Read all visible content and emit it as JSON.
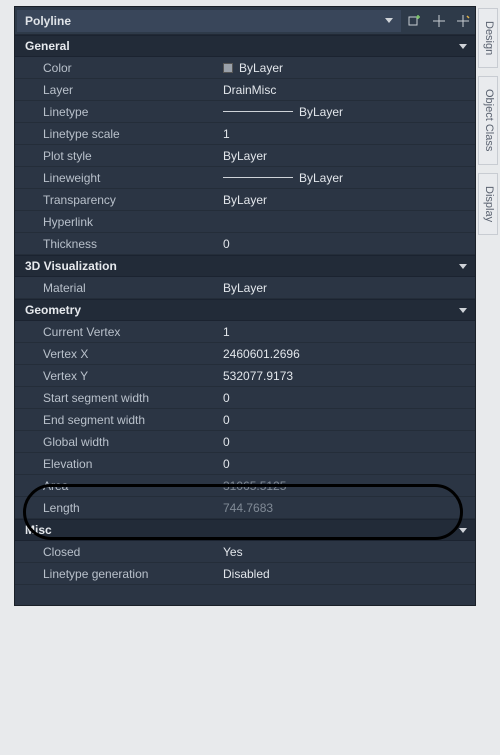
{
  "selector": {
    "value": "Polyline"
  },
  "sidetabs": [
    "Design",
    "Object Class",
    "Display"
  ],
  "sections": {
    "general": {
      "title": "General",
      "rows": [
        {
          "label": "Color",
          "value": "ByLayer",
          "swatch": true
        },
        {
          "label": "Layer",
          "value": "DrainMisc"
        },
        {
          "label": "Linetype",
          "value": "ByLayer",
          "line": true
        },
        {
          "label": "Linetype scale",
          "value": "1"
        },
        {
          "label": "Plot style",
          "value": "ByLayer"
        },
        {
          "label": "Lineweight",
          "value": "ByLayer",
          "line": true
        },
        {
          "label": "Transparency",
          "value": "ByLayer"
        },
        {
          "label": "Hyperlink",
          "value": ""
        },
        {
          "label": "Thickness",
          "value": "0"
        }
      ]
    },
    "viz3d": {
      "title": "3D Visualization",
      "rows": [
        {
          "label": "Material",
          "value": "ByLayer"
        }
      ]
    },
    "geometry": {
      "title": "Geometry",
      "rows": [
        {
          "label": "Current Vertex",
          "value": "1"
        },
        {
          "label": "Vertex X",
          "value": "2460601.2696"
        },
        {
          "label": "Vertex Y",
          "value": "532077.9173"
        },
        {
          "label": "Start segment width",
          "value": "0"
        },
        {
          "label": "End segment width",
          "value": "0"
        },
        {
          "label": "Global width",
          "value": "0"
        },
        {
          "label": "Elevation",
          "value": "0"
        },
        {
          "label": "Area",
          "value": "31065.5125",
          "readonly": true
        },
        {
          "label": "Length",
          "value": "744.7683",
          "readonly": true
        }
      ]
    },
    "misc": {
      "title": "Misc",
      "rows": [
        {
          "label": "Closed",
          "value": "Yes"
        },
        {
          "label": "Linetype generation",
          "value": "Disabled"
        }
      ]
    }
  }
}
